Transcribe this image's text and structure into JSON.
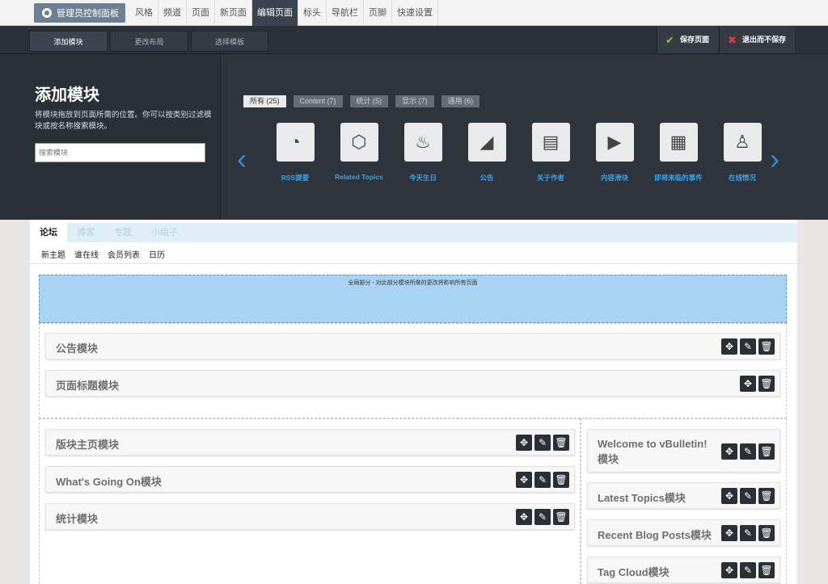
{
  "topbar": {
    "admin_label": "管理员控制面板",
    "tabs": [
      "风格",
      "频道",
      "页面",
      "新页面",
      "编辑页面",
      "标头",
      "导航栏",
      "页脚",
      "快速设置"
    ]
  },
  "editbar": {
    "add_module": "添加模块",
    "change_layout": "更改布局",
    "select_template": "选择模板",
    "save_page": "保存页面",
    "exit_no_save": "退出而不保存"
  },
  "panel": {
    "title": "添加模块",
    "description": "将模块拖放到页面所需的位置。你可以按类别过滤模块或按名称搜索模块。",
    "search_placeholder": "搜索模块",
    "filters": [
      "所有 (25)",
      "Content (7)",
      "统计 (5)",
      "显示 (7)",
      "通用 (6)"
    ],
    "modules": [
      {
        "label": "RSS提要",
        "icon": "rss-icon"
      },
      {
        "label": "Related Topics",
        "icon": "cubes-icon"
      },
      {
        "label": "今天生日",
        "icon": "cake-icon"
      },
      {
        "label": "公告",
        "icon": "megaphone-icon"
      },
      {
        "label": "关于作者",
        "icon": "author-card-icon"
      },
      {
        "label": "内容滑块",
        "icon": "slideshow-icon"
      },
      {
        "label": "即将来临的事件",
        "icon": "calendar-icon"
      },
      {
        "label": "在线情况",
        "icon": "user-icon"
      }
    ]
  },
  "forum": {
    "tabs": [
      "论坛",
      "博客",
      "专题",
      "小组子"
    ],
    "subnav": [
      "新主题",
      "谁在线",
      "会员列表",
      "日历"
    ],
    "global_notice": "全局部分 - 对此部分模块所做的更改将影响所有页面"
  },
  "blocks": {
    "top": [
      "公告模块",
      "页面标题模块"
    ],
    "left": [
      "版块主页模块",
      "What's Going On模块",
      "统计模块"
    ],
    "right": [
      "Welcome to vBulletin! 模块",
      "Latest Topics模块",
      "Recent Blog Posts模块",
      "Tag Cloud模块"
    ]
  }
}
